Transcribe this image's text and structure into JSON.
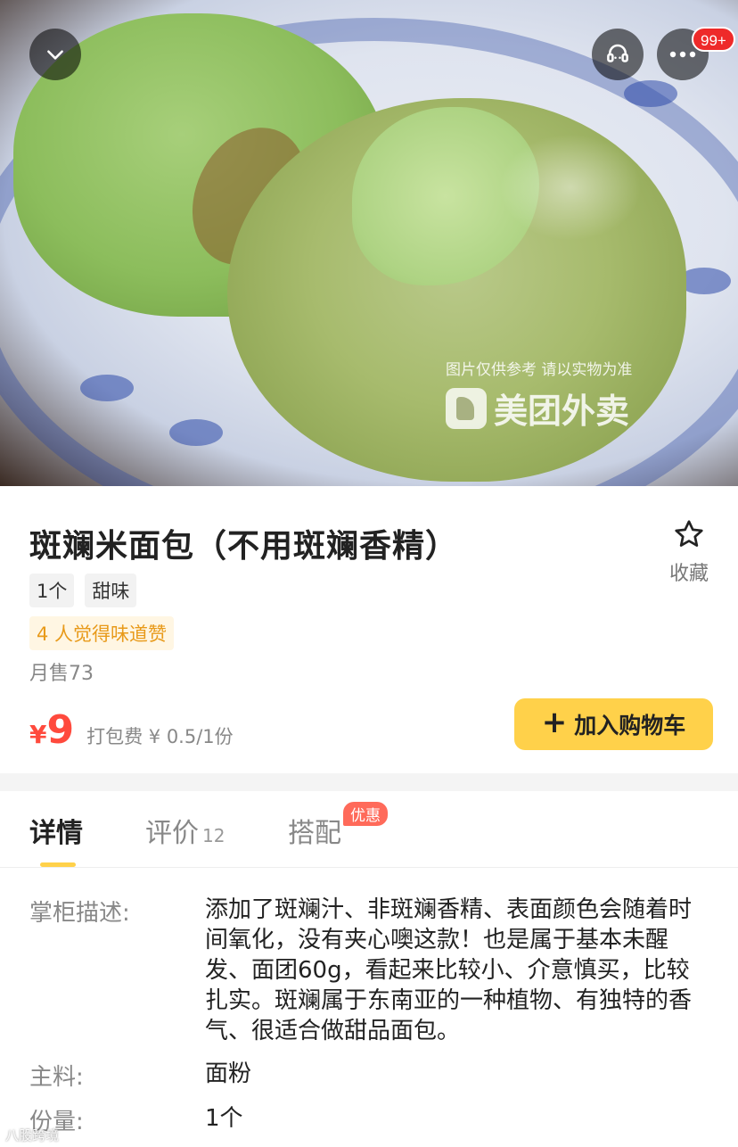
{
  "hero": {
    "watermark_note": "图片仅供参考 请以实物为准",
    "watermark_brand": "美团外卖",
    "message_badge": "99+"
  },
  "product": {
    "title": "斑斓米面包（不用斑斓香精）",
    "favorite_label": "收藏",
    "tags": [
      "1个",
      "甜味"
    ],
    "praise": "4 人觉得味道赞",
    "monthly_sales": "月售73",
    "price_symbol": "¥",
    "price_value": "9",
    "pack_fee": "打包费 ¥ 0.5/1份",
    "add_to_cart_label": "加入购物车"
  },
  "tabs": {
    "detail": "详情",
    "review": "评价",
    "review_count": "12",
    "match": "搭配",
    "match_badge": "优惠"
  },
  "details": {
    "desc_label": "掌柜描述:",
    "desc_value": "添加了斑斓汁、非斑斓香精、表面颜色会随着时间氧化，没有夹心噢这款！也是属于基本未醒发、面团60g，看起来比较小、介意慎买，比较扎实。斑斓属于东南亚的一种植物、有独特的香气、很适合做甜品面包。",
    "main_label": "主料:",
    "main_value": "面粉",
    "qty_label": "份量:",
    "qty_value": "1个"
  },
  "footer_watermark": "八股跨境",
  "colors": {
    "accent_yellow": "#ffd14a",
    "price_red": "#ff4a3d",
    "praise_orange": "#e89a1a",
    "badge_red": "#ee2a2a"
  }
}
